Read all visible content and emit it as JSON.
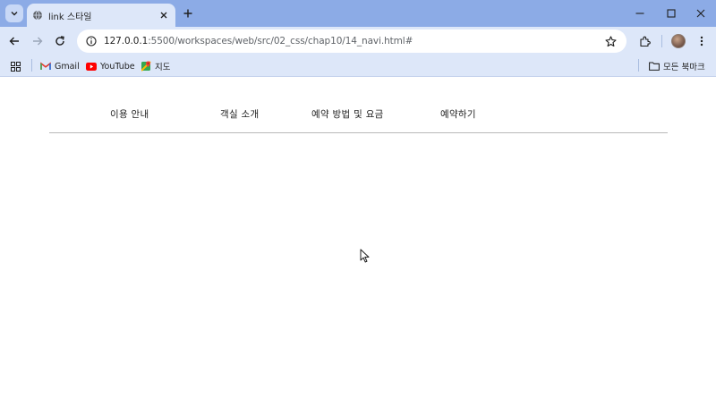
{
  "browser": {
    "tab": {
      "title": "link 스타일"
    },
    "address_bar": {
      "host": "127.0.0.1",
      "rest": ":5500/workspaces/web/src/02_css/chap10/14_navi.html#"
    },
    "bookmarks": [
      {
        "label": "Gmail",
        "icon": "gmail-icon"
      },
      {
        "label": "YouTube",
        "icon": "youtube-icon"
      },
      {
        "label": "지도",
        "icon": "maps-icon"
      }
    ],
    "all_bookmarks_label": "모든 북마크"
  },
  "page": {
    "nav_items": [
      {
        "label": "이용 안내"
      },
      {
        "label": "객실 소개"
      },
      {
        "label": "예약 방법 및 요금"
      },
      {
        "label": "예약하기"
      }
    ]
  },
  "colors": {
    "titlebar": "#8cabe6",
    "toolbar": "#dde7f9",
    "accent": "#1a73e8"
  }
}
